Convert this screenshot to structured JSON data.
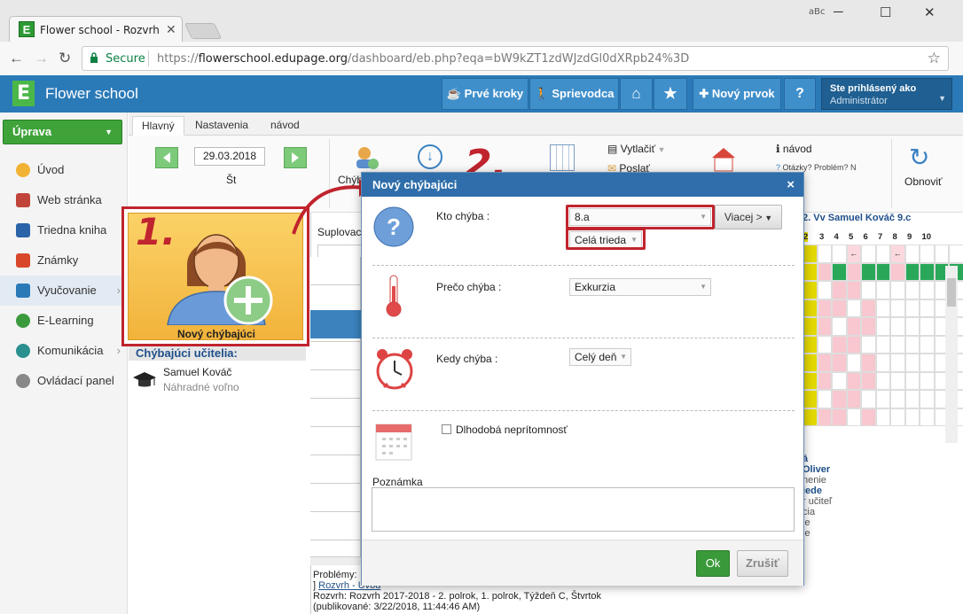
{
  "browser": {
    "tab_title": "Flower school - Rozvrh",
    "security_label": "Secure",
    "url_scheme": "https://",
    "url_host": "flowerschool.edupage.org",
    "url_path": "/dashboard/eb.php?eqa=bW9kZT1zdWJzdGl0dXRpb24%3D",
    "extension_label": "aBc"
  },
  "app": {
    "logo_letter": "E",
    "name": "Flower school",
    "header_buttons": [
      {
        "label": "Prvé kroky"
      },
      {
        "label": "Sprievodca"
      },
      {
        "label": "Nový prvok"
      },
      {
        "label": "?"
      }
    ],
    "user": {
      "line1": "Ste prihlásený ako",
      "line2": "Administrátor"
    }
  },
  "sidebar": {
    "edit_button": "Úprava",
    "items": [
      {
        "label": "Úvod",
        "color": "#f2b233"
      },
      {
        "label": "Web stránka",
        "color": "#c1443b"
      },
      {
        "label": "Triedna kniha",
        "color": "#2b63a8"
      },
      {
        "label": "Známky",
        "color": "#d9472b"
      },
      {
        "label": "Vyučovanie",
        "color": "#2b7ab8"
      },
      {
        "label": "E-Learning",
        "color": "#3b9a3b"
      },
      {
        "label": "Komunikácia",
        "color": "#2b8f8f"
      },
      {
        "label": "Ovládací panel",
        "color": "#888888"
      }
    ]
  },
  "ribbon": {
    "tabs": [
      "Hlavný",
      "Nastavenia",
      "návod"
    ],
    "date": "29.03.2018",
    "day": "Št",
    "buttons": {
      "vytlacit": "Vytlačiť",
      "poslat": "Poslať",
      "navod": "návod",
      "otazky": "Otázky? Problém? N",
      "obnovit": "Obnoviť",
      "chyb": "Chýb"
    }
  },
  "left_panel": {
    "callout_number": "1.",
    "new_absent_label": "Nový chýbajúci",
    "missing_teachers_header": "Chýbajúci učitelia:",
    "teacher_name": "Samuel Kováč",
    "teacher_note": "Náhradné voľno"
  },
  "center": {
    "supl_label": "Suplovac",
    "problems_label": "Problémy:",
    "link_text": "Rozvrh - Úvod",
    "footer_line1": "Rozvrh: Rozvrh 2017-2018 - 2. polrok, 1. polrok, Týždeň C, Štvrtok",
    "footer_line2": "(publikované: 3/22/2018, 11:44:46 AM)"
  },
  "right_panel": {
    "header": "2. Vv Samuel Kováč 9.c",
    "periods": [
      "2",
      "3",
      "4",
      "5",
      "6",
      "7",
      "8",
      "9",
      "10"
    ],
    "list": [
      "á",
      "Oliver",
      "nenie",
      "iede",
      "r učiteľ",
      "cia",
      "ie",
      "ie"
    ]
  },
  "dialog": {
    "callout_number": "2.",
    "title": "Nový chýbajúci",
    "close": "×",
    "who_label": "Kto chýba :",
    "who_value": "8.a",
    "more_button": "Viacej >",
    "scope_value": "Celá trieda",
    "why_label": "Prečo chýba :",
    "why_value": "Exkurzia",
    "when_label": "Kedy chýba :",
    "when_value": "Celý deň",
    "long_term_label": "Dlhodobá neprítomnosť",
    "note_label": "Poznámka",
    "ok_button": "Ok",
    "cancel_button": "Zrušiť"
  }
}
